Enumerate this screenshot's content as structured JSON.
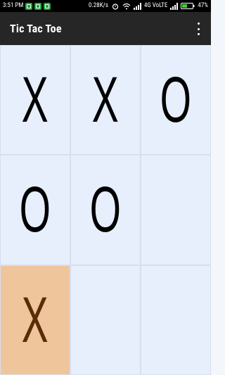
{
  "status_bar": {
    "time": "3:51 PM",
    "speed": "0.28K/s",
    "network": "4G VoLTE",
    "battery": "47%"
  },
  "app": {
    "title": "Tic Tac Toe"
  },
  "board": {
    "cells": [
      "X",
      "X",
      "O",
      "O",
      "O",
      "",
      "X",
      "",
      ""
    ],
    "highlighted_index": 6
  },
  "colors": {
    "cell_bg": "#e7effd",
    "highlight_bg": "#efc59b",
    "highlight_mark": "#5a2d08",
    "mark": "#000000",
    "app_bar": "#262626"
  }
}
